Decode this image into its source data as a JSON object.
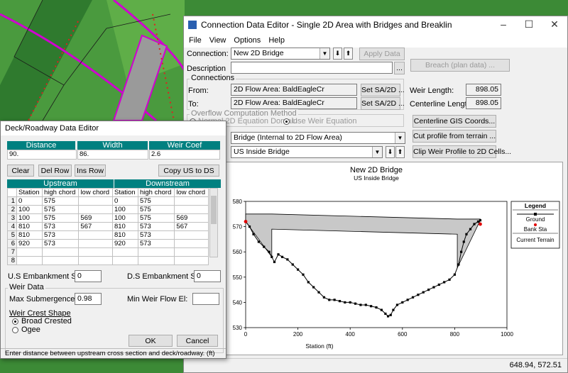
{
  "main_window": {
    "title": "Connection Data Editor - Single 2D Area with Bridges and Breaklin",
    "menu": [
      "File",
      "View",
      "Options",
      "Help"
    ],
    "connection_label": "Connection:",
    "connection_value": "New 2D Bridge",
    "apply_data": "Apply Data",
    "description_label": "Description",
    "description_value": "",
    "breach_button": "Breach (plan data) ...",
    "connections_group": "Connections",
    "from_label": "From:",
    "from_value": "2D Flow Area: BaldEagleCr",
    "to_label": "To:",
    "to_value": "2D Flow Area: BaldEagleCr",
    "set_sa_from": "Set SA/2D ...",
    "set_sa_to": "Set SA/2D ...",
    "weir_length_label": "Weir Length:",
    "weir_length_value": "898.05",
    "centerline_length_label": "Centerline Length:",
    "centerline_length_value": "898.05",
    "overflow_group": "Overflow Computation Method",
    "overflow_opt1": "Normal 2D Equation Domain",
    "overflow_opt2": "Use Weir Equation",
    "centerline_gis_button": "Centerline GIS Coords...",
    "cut_profile_button": "Cut profile from terrain ...",
    "clip_weir_button": "Clip Weir Profile to 2D Cells...",
    "type_value": "Bridge (Internal to 2D Flow Area)",
    "bridge_value": "US Inside Bridge",
    "status_coords": "648.94, 572.51"
  },
  "chart_data": {
    "type": "line",
    "title": "New 2D Bridge",
    "subtitle": "US Inside Bridge",
    "xlabel": "Station (ft)",
    "ylabel": "",
    "xlim": [
      0,
      1000
    ],
    "ylim": [
      530,
      580
    ],
    "xticks": [
      0,
      200,
      400,
      600,
      800,
      1000
    ],
    "yticks": [
      530,
      540,
      550,
      560,
      570,
      580
    ],
    "legend": {
      "title": "Legend",
      "entries": [
        "Ground",
        "Bank Sta",
        "Current Terrain"
      ]
    },
    "series": [
      {
        "name": "Ground",
        "x": [
          0,
          15,
          30,
          50,
          70,
          90,
          100,
          110,
          125,
          140,
          160,
          180,
          200,
          220,
          240,
          260,
          280,
          300,
          320,
          340,
          360,
          380,
          400,
          420,
          440,
          460,
          480,
          500,
          520,
          535,
          545,
          555,
          565,
          580,
          600,
          620,
          640,
          660,
          680,
          700,
          720,
          740,
          760,
          780,
          800,
          815,
          825,
          835,
          845,
          860,
          875,
          890,
          898
        ],
        "y": [
          572,
          570,
          567,
          564,
          562,
          560,
          558,
          556,
          559,
          558,
          557,
          555,
          553,
          551,
          548,
          546,
          544,
          542,
          541,
          541,
          540.5,
          540,
          540,
          539.5,
          539,
          539,
          538.5,
          538,
          537,
          535.5,
          534.5,
          535,
          537,
          539,
          540,
          541,
          542,
          543,
          544,
          545,
          546,
          547,
          548,
          549,
          551,
          555,
          560,
          564,
          567,
          569,
          571,
          572,
          572.5
        ]
      },
      {
        "name": "Bank Sta",
        "x": [
          0,
          898
        ],
        "y": [
          572,
          571
        ]
      }
    ],
    "deck": {
      "top": [
        [
          0,
          575
        ],
        [
          100,
          575
        ],
        [
          810,
          573
        ],
        [
          898,
          573
        ]
      ],
      "low_chord": [
        [
          100,
          569
        ],
        [
          810,
          567
        ]
      ]
    }
  },
  "deck_editor": {
    "title": "Deck/Roadway Data Editor",
    "distance_label": "Distance",
    "width_label": "Width",
    "weir_coef_label": "Weir Coef",
    "distance_value": "90.",
    "width_value": "86.",
    "weir_coef_value": "2.6",
    "clear": "Clear",
    "del_row": "Del Row",
    "ins_row": "Ins Row",
    "copy_us_ds": "Copy US to DS",
    "upstream": "Upstream",
    "downstream": "Downstream",
    "columns": [
      "Station",
      "high chord",
      "low chord",
      "Station",
      "high chord",
      "low chord"
    ],
    "rows": [
      [
        "1",
        "0",
        "575",
        "",
        "0",
        "575",
        ""
      ],
      [
        "2",
        "100",
        "575",
        "",
        "100",
        "575",
        ""
      ],
      [
        "3",
        "100",
        "575",
        "569",
        "100",
        "575",
        "569"
      ],
      [
        "4",
        "810",
        "573",
        "567",
        "810",
        "573",
        "567"
      ],
      [
        "5",
        "810",
        "573",
        "",
        "810",
        "573",
        ""
      ],
      [
        "6",
        "920",
        "573",
        "",
        "920",
        "573",
        ""
      ],
      [
        "7",
        "",
        "",
        "",
        "",
        "",
        ""
      ],
      [
        "8",
        "",
        "",
        "",
        "",
        "",
        ""
      ]
    ],
    "us_emb_label": "U.S Embankment SS",
    "us_emb_value": "0",
    "ds_emb_label": "D.S Embankment SS",
    "ds_emb_value": "0",
    "weir_data_group": "Weir Data",
    "max_sub_label": "Max  Submergence:",
    "max_sub_value": "0.98",
    "min_weir_label": "Min Weir Flow El:",
    "min_weir_value": "",
    "crest_shape_label": "Weir Crest Shape",
    "broad_crested": "Broad Crested",
    "ogee": "Ogee",
    "ok": "OK",
    "cancel": "Cancel",
    "status": "Enter distance between upstream cross section and deck/roadway. (ft)"
  }
}
